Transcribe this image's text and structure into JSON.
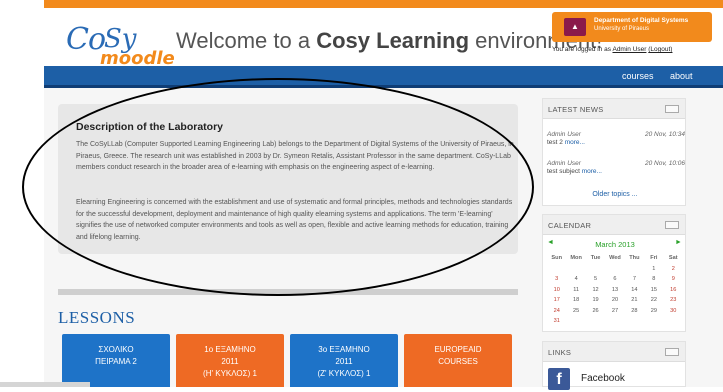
{
  "header": {
    "logo_co": "Co",
    "logo_sy": "Sy",
    "logo_moodle": "moodle",
    "welcome_prefix": "Welcome to a ",
    "welcome_bold": "Cosy Learning",
    "welcome_suffix": " environment!",
    "dept_line1": "Department of Digital Systems",
    "dept_line2": "University of Piraeus",
    "logged_in_prefix": "You are logged in as ",
    "logged_in_user": "Admin User",
    "logout_label": "(Logout)"
  },
  "nav": {
    "courses": "courses",
    "about": "about"
  },
  "description": {
    "title": "Description of the Laboratory",
    "p1": "The CoSyLLab (Computer Supported Learning Engineering Lab) belongs to the Department of Digital Systems of the University of Piraeus, in Piraeus, Greece. The research unit was established in 2003 by Dr. Symeon Retalis, Assistant Professor in the same department. CoSy-LLab members conduct research in the broader area of e-learning with emphasis on the engineering aspect of e-learning.",
    "p2": "Elearning Engineering is concerned with the establishment and use of systematic and formal principles, methods and technologies standards for the successful development, deployment and maintenance of high quality elearning systems and applications. The term 'E-learning' signifies the use of networked computer environments and tools as well as open, flexible and active learning methods for education, training and lifelong learning."
  },
  "lessons": {
    "title": "LESSONS",
    "courses": [
      {
        "line1": "ΣΧΟΛΙΚΟ",
        "line2": "ΠΕΙΡΑΜΑ 2",
        "line3": ""
      },
      {
        "line1": "1ο ΕΞΑΜΗΝΟ",
        "line2": "2011",
        "line3": "(Η' ΚΥΚΛΟΣ) 1"
      },
      {
        "line1": "3ο ΕΞΑΜΗΝΟ",
        "line2": "2011",
        "line3": "(Ζ' ΚΥΚΛΟΣ) 1"
      },
      {
        "line1": "EUROPEAID",
        "line2": "COURSES",
        "line3": ""
      }
    ]
  },
  "news": {
    "title": "LATEST NEWS",
    "posts": [
      {
        "author": "Admin User",
        "date": "20 Nov, 10:34",
        "subject": "test 2",
        "more": "more..."
      },
      {
        "author": "Admin User",
        "date": "20 Nov, 10:06",
        "subject": "test subject",
        "more": "more..."
      }
    ],
    "older": "Older topics ..."
  },
  "calendar": {
    "title": "CALENDAR",
    "prev": "◄",
    "next": "►",
    "month": "March 2013",
    "days": [
      "Sun",
      "Mon",
      "Tue",
      "Wed",
      "Thu",
      "Fri",
      "Sat"
    ],
    "weeks": [
      [
        "",
        "",
        "",
        "",
        "",
        "1",
        "2"
      ],
      [
        "3",
        "4",
        "5",
        "6",
        "7",
        "8",
        "9"
      ],
      [
        "10",
        "11",
        "12",
        "13",
        "14",
        "15",
        "16"
      ],
      [
        "17",
        "18",
        "19",
        "20",
        "21",
        "22",
        "23"
      ],
      [
        "24",
        "25",
        "26",
        "27",
        "28",
        "29",
        "30"
      ],
      [
        "31",
        "",
        "",
        "",
        "",
        "",
        ""
      ]
    ]
  },
  "links": {
    "title": "LINKS",
    "facebook": "Facebook",
    "fb_glyph": "f"
  },
  "colors": {
    "brand_blue": "#1d5fa6",
    "brand_orange": "#f28a1c",
    "tile_blue": "#1e73c8",
    "tile_orange": "#ee6a24"
  }
}
